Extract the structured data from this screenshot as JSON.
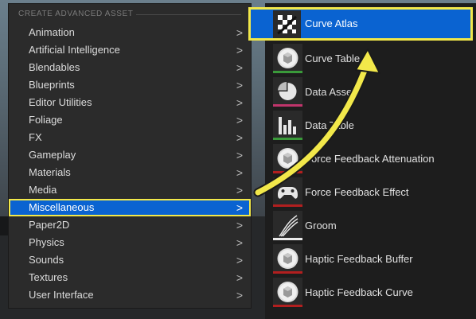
{
  "menu": {
    "section_title": "CREATE ADVANCED ASSET",
    "items": [
      {
        "label": "Animation"
      },
      {
        "label": "Artificial Intelligence"
      },
      {
        "label": "Blendables"
      },
      {
        "label": "Blueprints"
      },
      {
        "label": "Editor Utilities"
      },
      {
        "label": "Foliage"
      },
      {
        "label": "FX"
      },
      {
        "label": "Gameplay"
      },
      {
        "label": "Materials"
      },
      {
        "label": "Media"
      },
      {
        "label": "Miscellaneous",
        "selected": true
      },
      {
        "label": "Paper2D"
      },
      {
        "label": "Physics"
      },
      {
        "label": "Sounds"
      },
      {
        "label": "Textures"
      },
      {
        "label": "User Interface"
      }
    ],
    "chevron": ">"
  },
  "submenu": {
    "items": [
      {
        "label": "Curve Atlas",
        "icon": "checker-icon",
        "bar_color": "#2a2a2a",
        "selected": true
      },
      {
        "label": "Curve Table",
        "icon": "cube-icon",
        "bar_color": "#3a9a3a"
      },
      {
        "label": "Data Asset",
        "icon": "pie-icon",
        "bar_color": "#c0356b"
      },
      {
        "label": "Data Table",
        "icon": "barchart-icon",
        "bar_color": "#3a9a3a"
      },
      {
        "label": "Force Feedback Attenuation",
        "icon": "cube-icon",
        "bar_color": "#b21f1f"
      },
      {
        "label": "Force Feedback Effect",
        "icon": "gamepad-icon",
        "bar_color": "#b21f1f"
      },
      {
        "label": "Groom",
        "icon": "hair-icon",
        "bar_color": "#eaeaea"
      },
      {
        "label": "Haptic Feedback Buffer",
        "icon": "cube-icon",
        "bar_color": "#b21f1f"
      },
      {
        "label": "Haptic Feedback Curve",
        "icon": "cube-icon",
        "bar_color": "#b21f1f"
      }
    ]
  },
  "colors": {
    "selection": "#0a63d1",
    "highlight": "#f2e84a"
  }
}
